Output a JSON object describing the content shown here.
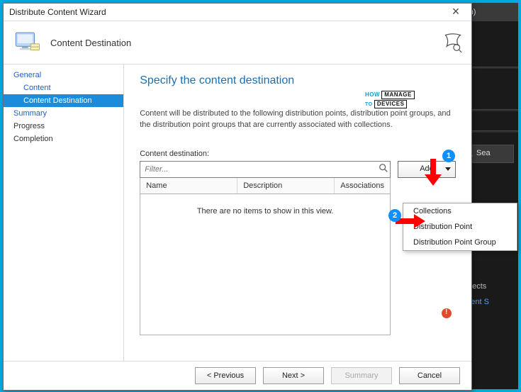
{
  "wizard": {
    "title": "Distribute Content Wizard",
    "header_title": "Content Destination",
    "steps": [
      {
        "label": "General",
        "kind": "link"
      },
      {
        "label": "Content",
        "kind": "sub link"
      },
      {
        "label": "Content Destination",
        "kind": "sub sel"
      },
      {
        "label": "Summary",
        "kind": "link"
      },
      {
        "label": "Progress",
        "kind": ""
      },
      {
        "label": "Completion",
        "kind": ""
      }
    ]
  },
  "pane": {
    "heading": "Specify the content destination",
    "description": "Content will be distributed to the following distribution points, distribution point groups, and the distribution point groups that are currently associated with collections.",
    "list_label": "Content destination:",
    "filter_placeholder": "Filter...",
    "columns": {
      "name": "Name",
      "description": "Description",
      "associations": "Associations"
    },
    "empty_text": "There are no items to show in this view.",
    "add_label": "Add"
  },
  "menu": {
    "items": [
      "Collections",
      "Distribution Point",
      "Distribution Point Group"
    ]
  },
  "footer": {
    "previous": "< Previous",
    "next": "Next >",
    "summary": "Summary",
    "cancel": "Cancel"
  },
  "background": {
    "title_fragment": "com)",
    "search_label": "Sea",
    "objects_label": "Objects",
    "content_link": "ontent S"
  },
  "watermark": {
    "l1": "HOW",
    "l2": "MANAGE",
    "l3": "TO",
    "l4": "DEVICES"
  },
  "callouts": {
    "one": "1",
    "two": "2"
  }
}
